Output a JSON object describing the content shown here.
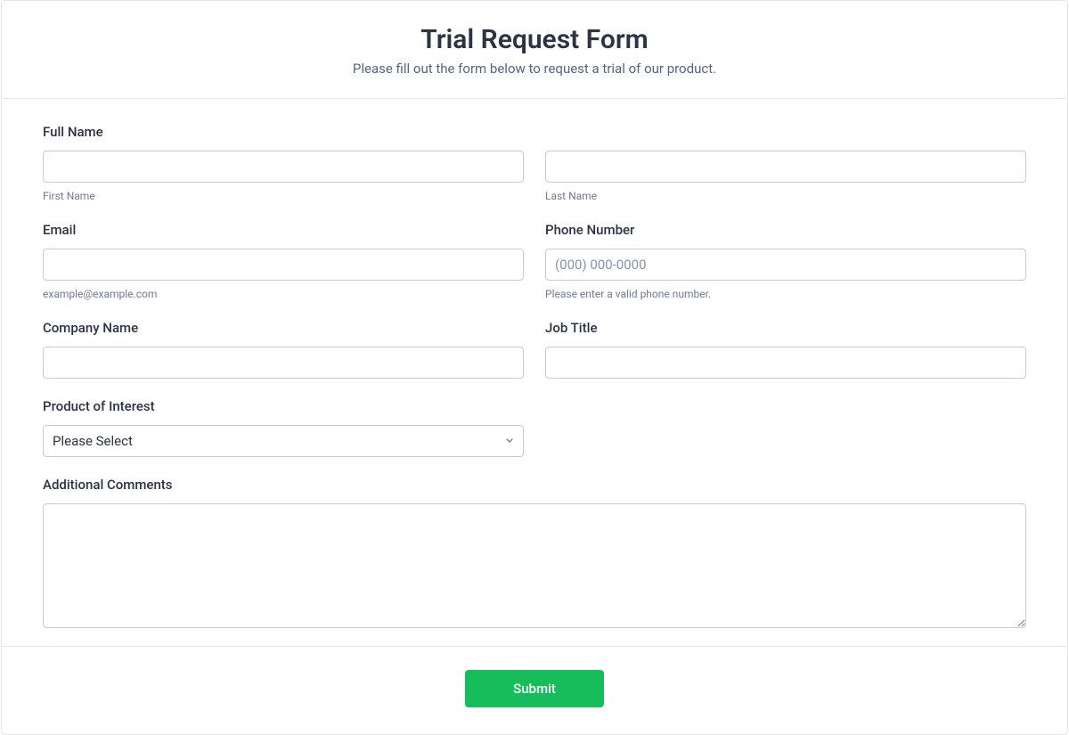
{
  "header": {
    "title": "Trial Request Form",
    "subtitle": "Please fill out the form below to request a trial of our product."
  },
  "fields": {
    "fullName": {
      "label": "Full Name",
      "firstSub": "First Name",
      "lastSub": "Last Name"
    },
    "email": {
      "label": "Email",
      "sub": "example@example.com"
    },
    "phone": {
      "label": "Phone Number",
      "placeholder": "(000) 000-0000",
      "sub": "Please enter a valid phone number."
    },
    "company": {
      "label": "Company Name"
    },
    "jobTitle": {
      "label": "Job Title"
    },
    "product": {
      "label": "Product of Interest",
      "selectedOption": "Please Select"
    },
    "comments": {
      "label": "Additional Comments"
    }
  },
  "footer": {
    "submitLabel": "Submit"
  }
}
